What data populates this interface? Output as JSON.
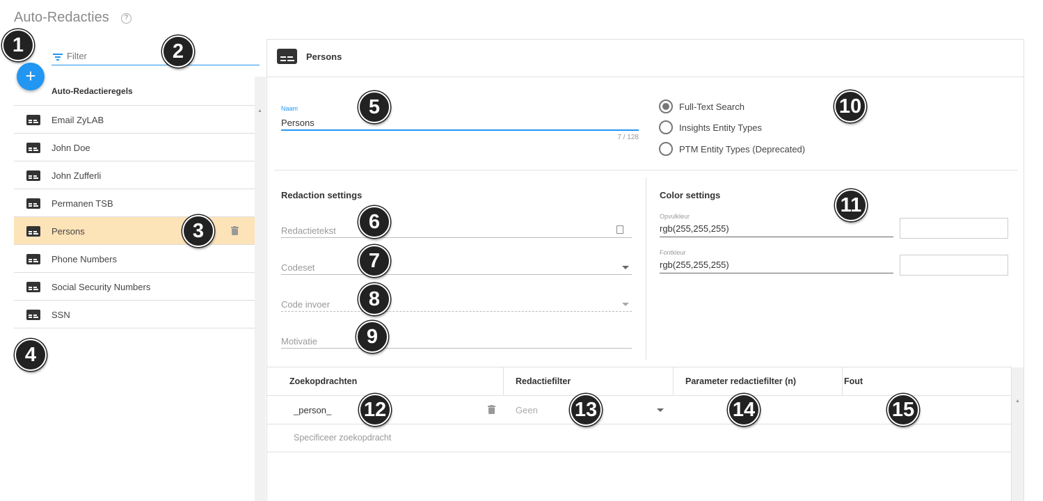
{
  "header": {
    "title": "Auto-Redacties",
    "help_icon": "?"
  },
  "sidebar": {
    "filter_placeholder": "Filter",
    "add_button_label": "+",
    "list_header": "Auto-Redactieregels",
    "items": [
      {
        "label": "Email ZyLAB",
        "icon": "subtitles-icon"
      },
      {
        "label": "John Doe",
        "icon": "subtitles-icon"
      },
      {
        "label": "John Zufferli",
        "icon": "subtitles-icon"
      },
      {
        "label": "Permanen TSB",
        "icon": "subtitles-icon"
      },
      {
        "label": "Persons",
        "icon": "subtitles-icon",
        "selected": true
      },
      {
        "label": "Phone Numbers",
        "icon": "subtitles-icon"
      },
      {
        "label": "Social Security Numbers",
        "icon": "subtitles-icon"
      },
      {
        "label": "SSN",
        "icon": "subtitles-icon"
      }
    ],
    "selected_color": "#fde3b8"
  },
  "main": {
    "title": "Persons",
    "naam": {
      "label": "Naam",
      "value": "Persons",
      "counter": "7 / 128"
    },
    "search_types": [
      {
        "label": "Full-Text Search",
        "checked": true
      },
      {
        "label": "Insights Entity Types",
        "checked": false
      },
      {
        "label": "PTM Entity Types (Deprecated)",
        "checked": false
      }
    ],
    "redaction_settings": {
      "title": "Redaction settings",
      "redactietekst": "Redactietekst",
      "codeset": "Codeset",
      "code_invoer": "Code invoer",
      "motivatie": "Motivatie"
    },
    "color_settings": {
      "title": "Color settings",
      "opvulkleur_label": "Opvulkleur",
      "opvulkleur_value": "rgb(255,255,255)",
      "fontkleur_label": "Fontkleur",
      "fontkleur_value": "rgb(255,255,255)"
    },
    "table": {
      "columns": [
        "Zoekopdrachten",
        "Redactiefilter",
        "Parameter redactiefilter (n)",
        "Fout"
      ],
      "rows": [
        {
          "query": "_person_",
          "filter": "Geen",
          "parameter": "",
          "error": ""
        }
      ],
      "new_row_placeholder": "Specificeer zoekopdracht"
    }
  },
  "callouts": [
    "1",
    "2",
    "3",
    "4",
    "5",
    "6",
    "7",
    "8",
    "9",
    "10",
    "11",
    "12",
    "13",
    "14",
    "15"
  ],
  "colors": {
    "accent": "#2196f3",
    "selected_row": "#fde3b8",
    "callout": "#222222"
  }
}
